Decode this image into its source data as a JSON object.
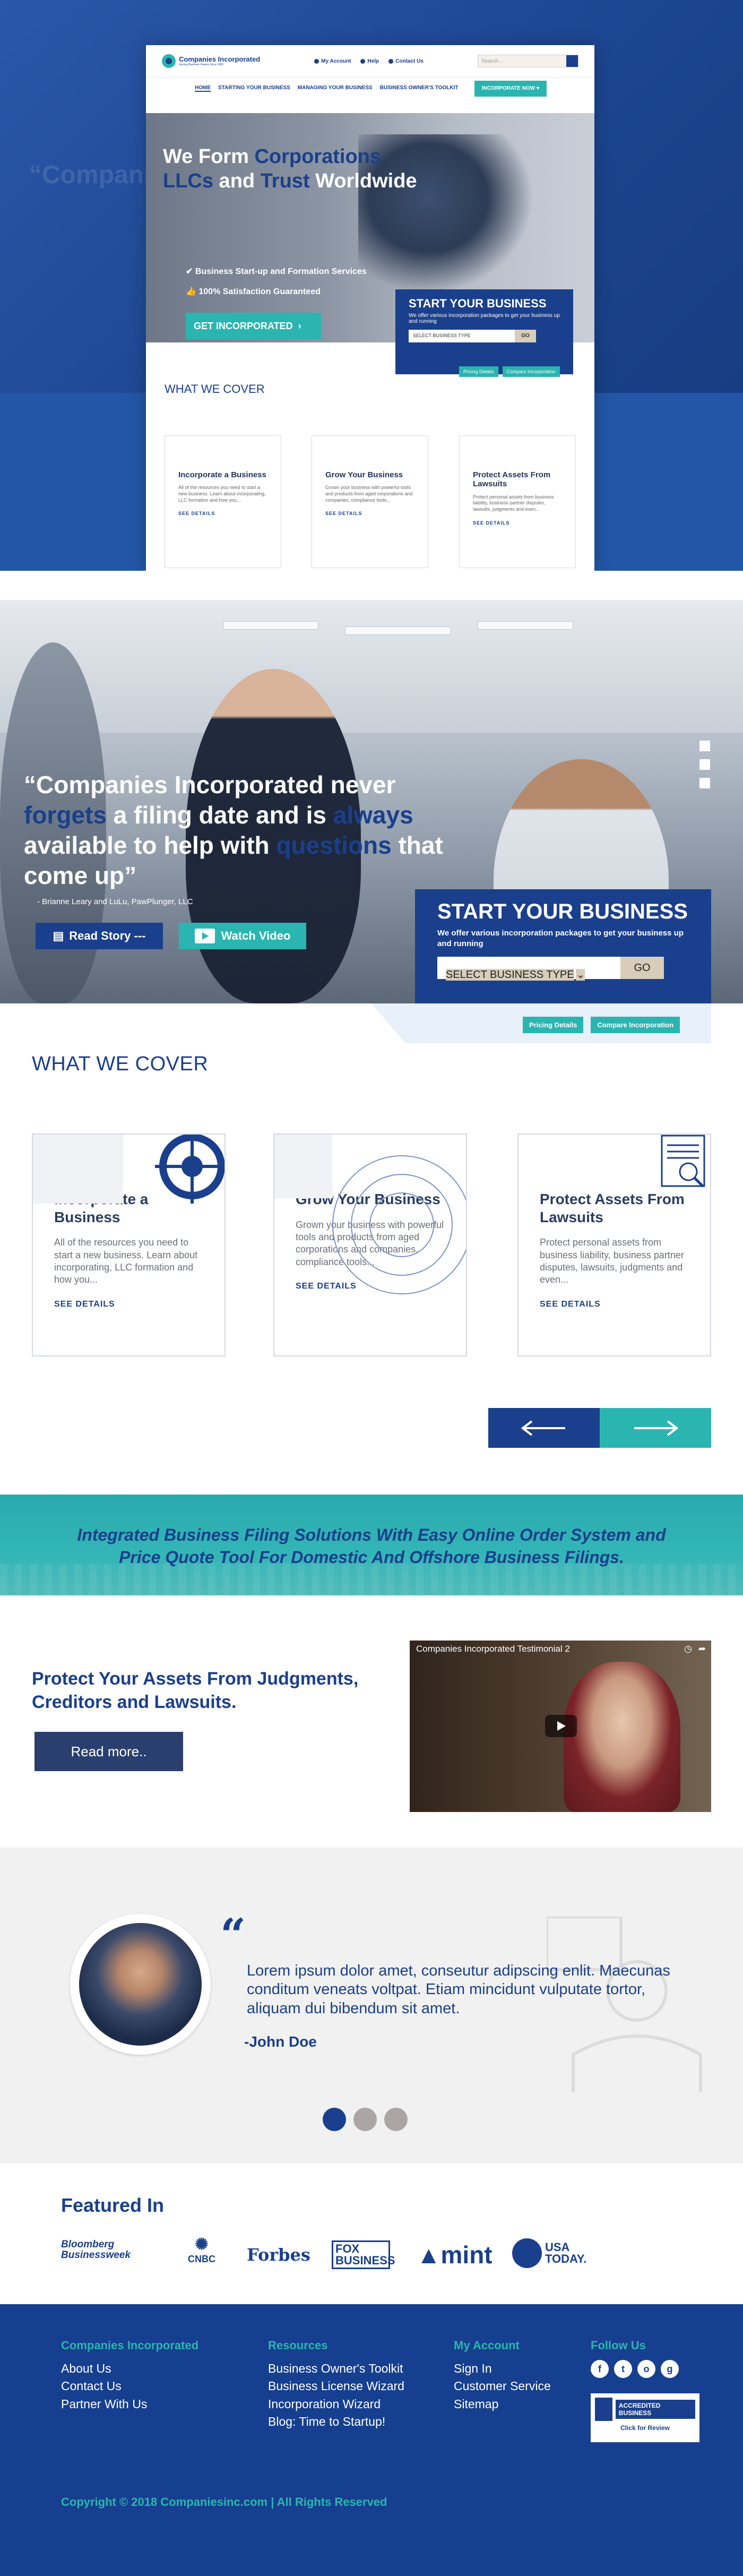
{
  "mockup": {
    "logo_title": "Companies Incorporated",
    "logo_sub": "Serving Business Owners Since 1995",
    "toplinks": [
      "My Account",
      "Help",
      "Contact Us"
    ],
    "search_placeholder": "Search...",
    "nav": [
      "HOME",
      "STARTING YOUR BUSINESS",
      "MANAGING YOUR BUSINESS",
      "BUSINESS OWNER'S TOOLKIT"
    ],
    "incorporate_now": "INCORPORATE NOW",
    "hero_line1_a": "We Form ",
    "hero_line1_b": "Corporations",
    "hero_line2_a": "LLCs",
    "hero_line2_b": " and ",
    "hero_line2_c": "Trust",
    "hero_line2_d": " Worldwide",
    "bullet1": "Business Start-up and Formation Services",
    "bullet2": "100% Satisfaction Guaranteed",
    "get_incorporated": "GET INCORPORATED",
    "box_title": "START YOUR BUSINESS",
    "box_sub": "We offer various incorporation packages to get your business up and running",
    "select": "SELECT BUSINESS TYPE",
    "go": "GO",
    "btn1": "Pricing Details",
    "btn2": "Compare Incorporation",
    "what_we_cover": "WHAT WE COVER",
    "cards": [
      {
        "title": "Incorporate a Business",
        "text": "All of the resources you need to start a new business. Learn about incorporating, LLC formation and how you...",
        "link": "SEE DETAILS"
      },
      {
        "title": "Grow Your Business",
        "text": "Grown your business with powerful tools and products from aged corporations and companies, compliance tools...",
        "link": "SEE DETAILS"
      },
      {
        "title": "Protect Assets From Lawsuits",
        "text": "Protect personal assets from business liability, business partner disputes, lawsuits, judgments and even...",
        "link": "SEE DETAILS"
      }
    ]
  },
  "hero": {
    "q1": "“Companies Incorporated never",
    "q2_b": "forgets",
    "q2_a": " a filing date and is ",
    "q2_c": "always",
    "q3_a": "available to help with ",
    "q3_b": "questions",
    "q3_c": " that",
    "q4": "come up”",
    "attribution": "- Brianne Leary and LuLu, PawPlunger, LLC",
    "read_story": "Read Story ---",
    "watch_video": "Watch Video",
    "box_title": "START YOUR BUSINESS",
    "box_sub": "We offer various incorporation packages to get your business up and running",
    "select": "SELECT BUSINESS TYPE",
    "go": "GO",
    "pricing": "Pricing Details",
    "compare": "Compare Incorporation"
  },
  "cover": {
    "title": "WHAT WE COVER",
    "cards": [
      {
        "title": "Incorporate a Business",
        "text": "All of the resources you need to start a new business. Learn about incorporating, LLC formation and how you...",
        "link": "SEE DETAILS"
      },
      {
        "title": "Grow Your Business",
        "text": "Grown your business with powerful tools and products from aged corporations and companies, compliance tools...",
        "link": "SEE DETAILS"
      },
      {
        "title": "Protect Assets From Lawsuits",
        "text": "Protect personal assets from business liability, business partner disputes, lawsuits, judgments and even...",
        "link": "SEE DETAILS"
      }
    ]
  },
  "banner": {
    "line1": "Integrated Business Filing Solutions With Easy Online Order System and",
    "line2": "Price Quote Tool For Domestic And Offshore Business Filings."
  },
  "protect": {
    "title": "Protect Your Assets From Judgments, Creditors and Lawsuits.",
    "read_more": "Read more..",
    "video_title": "Companies Incorporated Testimonial 2"
  },
  "testimonial": {
    "text": "Lorem ipsum dolor amet, conseutur adipscing enlit. Maecunas conditum veneats voltpat. Etiam mincidunt vulputate tortor, aliquam dui bibendum sit amet.",
    "author": "-John Doe"
  },
  "featured": {
    "title": "Featured In",
    "logos": [
      "Bloomberg Businessweek",
      "CNBC",
      "Forbes",
      "FOX BUSINESS",
      "mint",
      "USA TODAY."
    ]
  },
  "footer": {
    "col1_title": "Companies Incorporated",
    "col1": [
      "About Us",
      "Contact Us",
      "Partner With Us"
    ],
    "col2_title": "Resources",
    "col2": [
      "Business Owner's Toolkit",
      "Business License Wizard",
      "Incorporation Wizard",
      "Blog: Time to Startup!"
    ],
    "col3_title": "My Account",
    "col3": [
      "Sign In",
      "Customer Service",
      "Sitemap"
    ],
    "col4_title": "Follow Us",
    "social": [
      "f",
      "t",
      "o",
      "g"
    ],
    "bbb_line1": "ACCREDITED BUSINESS",
    "bbb_line2": "Click for Review",
    "copyright": "Copyright © 2018 Companiesinc.com | All Rights Reserved"
  },
  "colors": {
    "navy": "#1a3f8c",
    "teal": "#2bb5b0"
  }
}
